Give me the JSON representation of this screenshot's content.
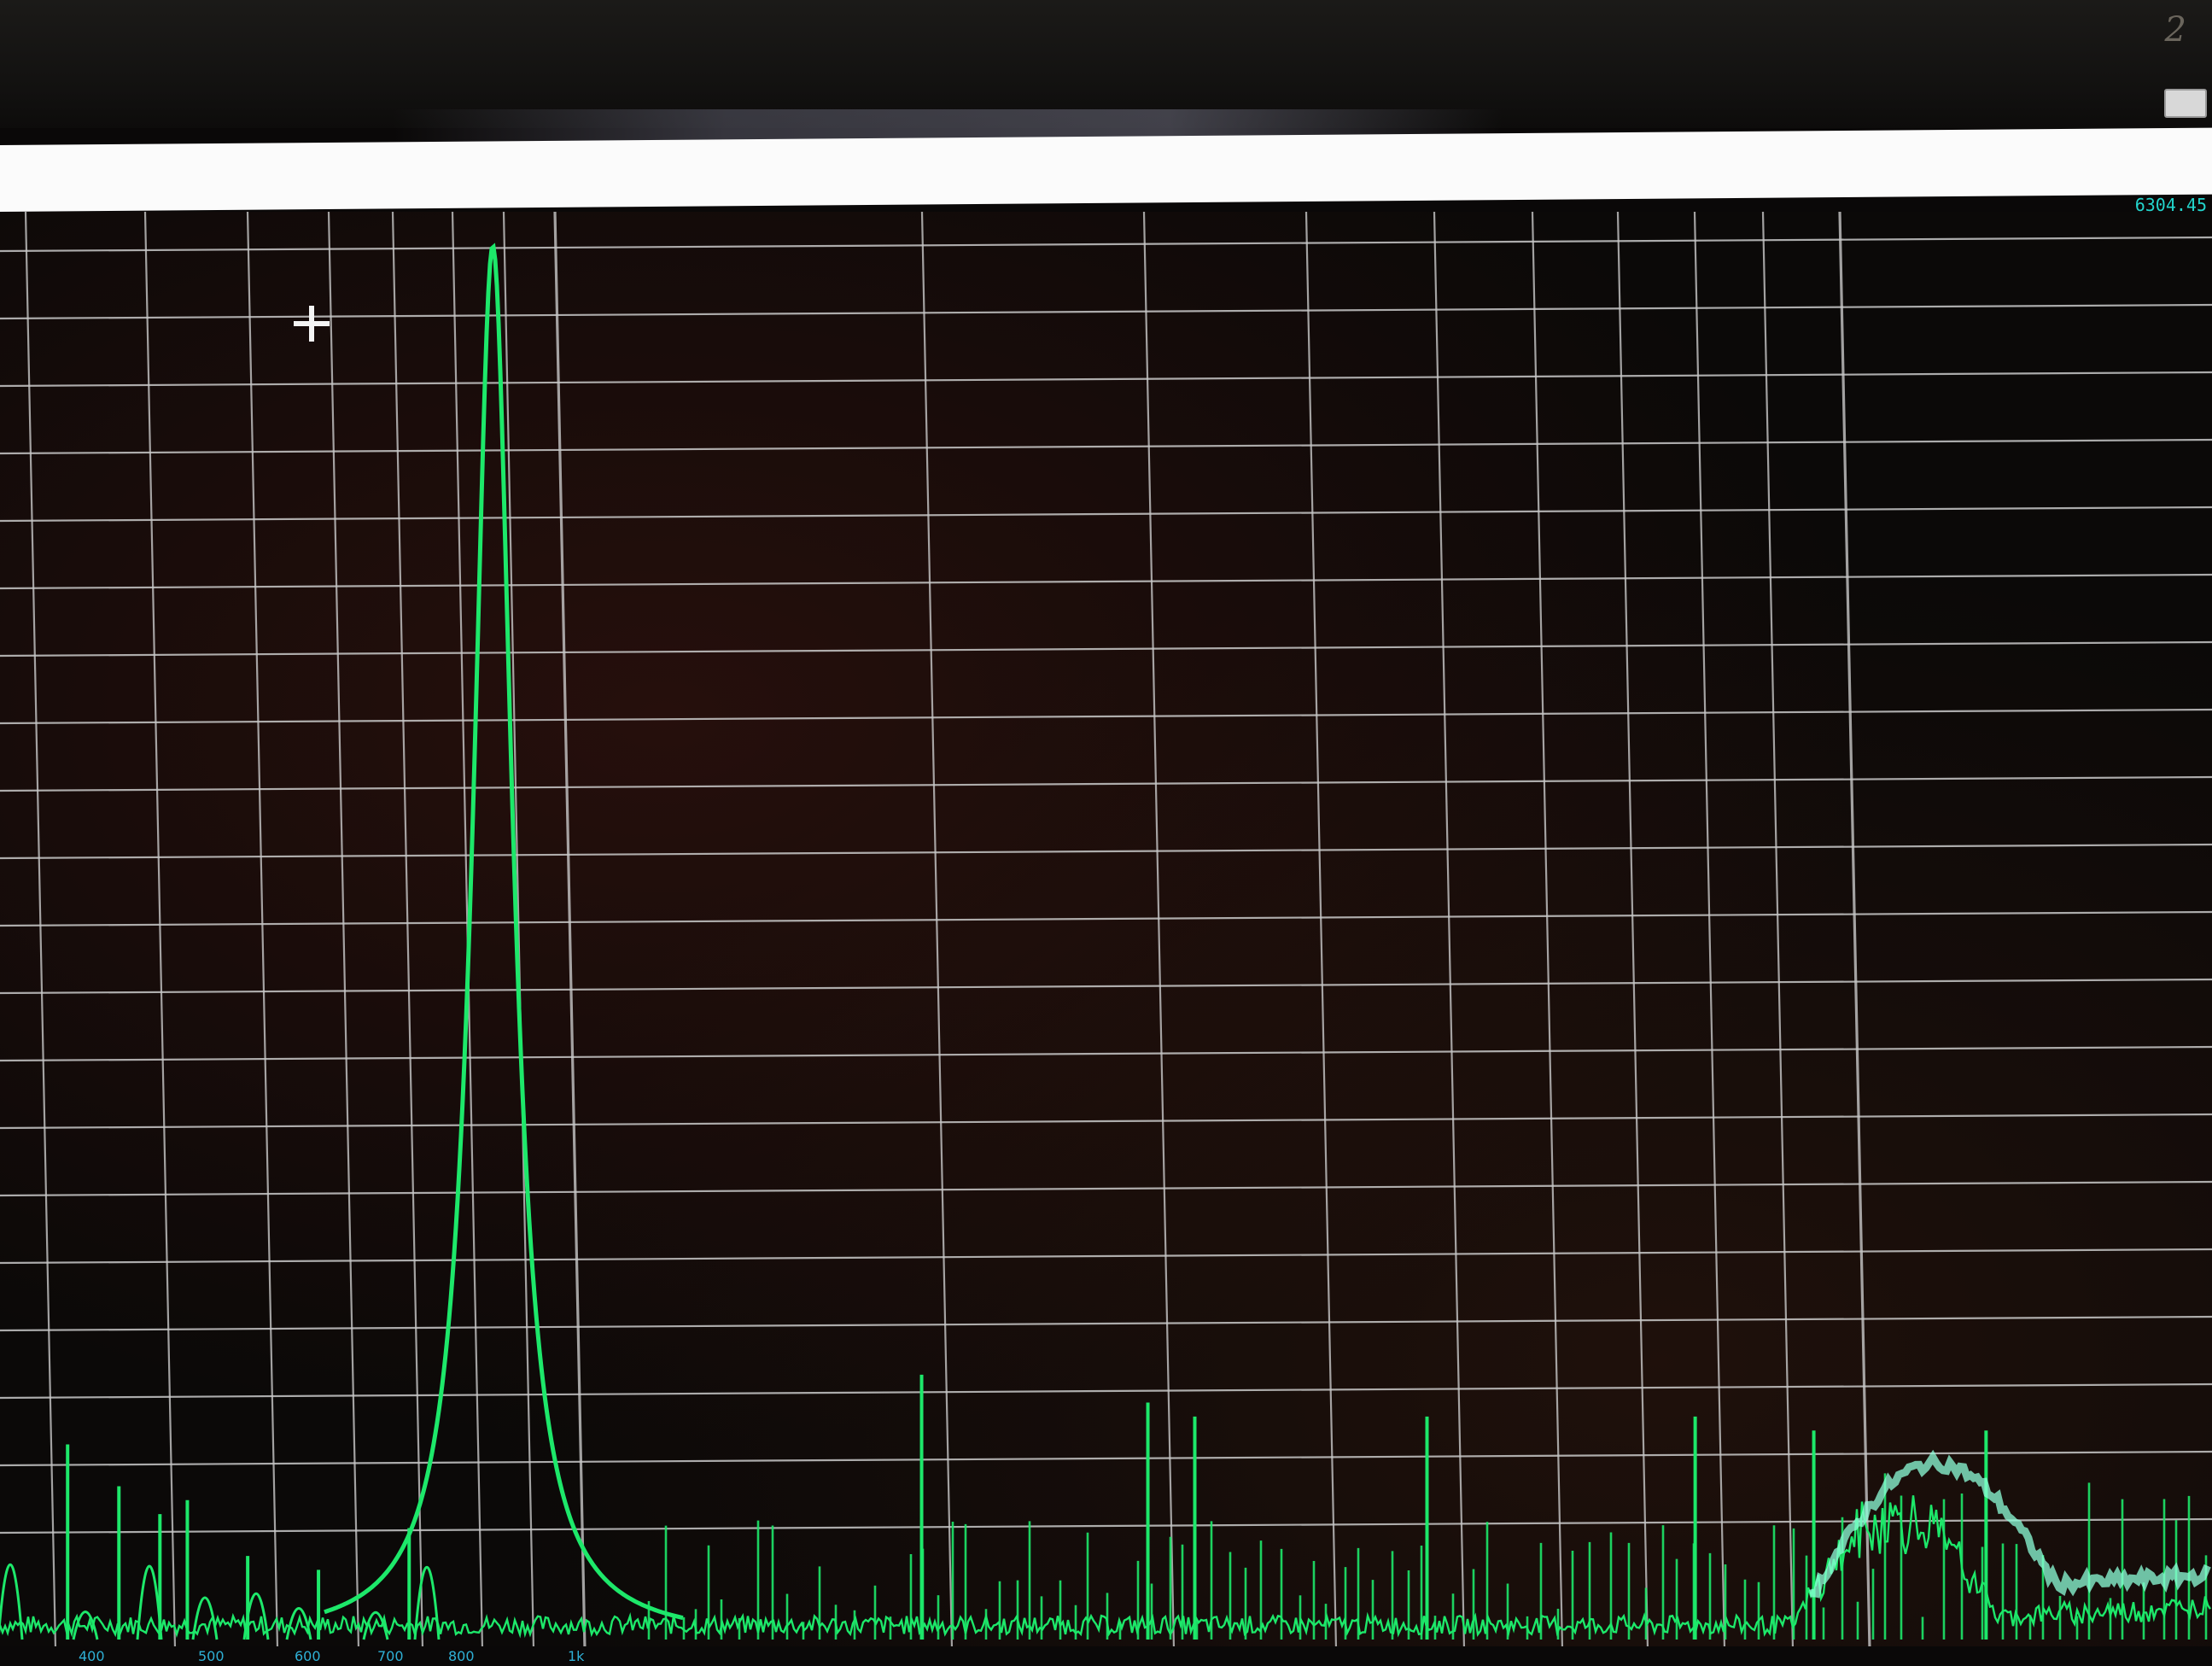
{
  "window": {
    "readout_text": "6304.45",
    "colors": {
      "background": "#0b0908",
      "grid": "#c8c8c8",
      "trace": "#1de86a",
      "trace_glow": "#8dffd9",
      "readout": "#23d4cc",
      "tick_labels": "#2fb0d6",
      "title_bar": "#fbfbfb"
    },
    "icons": {
      "cursor": "crosshair-cursor-icon",
      "corner_button": "window-button"
    }
  },
  "chart_data": {
    "type": "line",
    "title": "",
    "xlabel": "",
    "ylabel": "",
    "x_scale": "log",
    "grid": true,
    "legend": "none",
    "x_tick_labels": [
      "400",
      "500",
      "600",
      "700",
      "800",
      "1k"
    ],
    "x_tick_values": [
      400,
      500,
      600,
      700,
      800,
      1000
    ],
    "fundamental_peak": {
      "x": 950,
      "y_rel": 1.0
    },
    "series": [
      {
        "values_description": "spectrum trace",
        "peaks": [
          {
            "x": 380,
            "y_rel": 0.14
          },
          {
            "x": 420,
            "y_rel": 0.11
          },
          {
            "x": 455,
            "y_rel": 0.09
          },
          {
            "x": 480,
            "y_rel": 0.1
          },
          {
            "x": 540,
            "y_rel": 0.06
          },
          {
            "x": 620,
            "y_rel": 0.05
          },
          {
            "x": 740,
            "y_rel": 0.08
          },
          {
            "x": 1900,
            "y_rel": 0.19
          },
          {
            "x": 2850,
            "y_rel": 0.17
          },
          {
            "x": 3100,
            "y_rel": 0.16
          },
          {
            "x": 4700,
            "y_rel": 0.16
          },
          {
            "x": 7600,
            "y_rel": 0.16
          },
          {
            "x": 9400,
            "y_rel": 0.15
          },
          {
            "x": 12800,
            "y_rel": 0.15
          }
        ]
      }
    ]
  }
}
